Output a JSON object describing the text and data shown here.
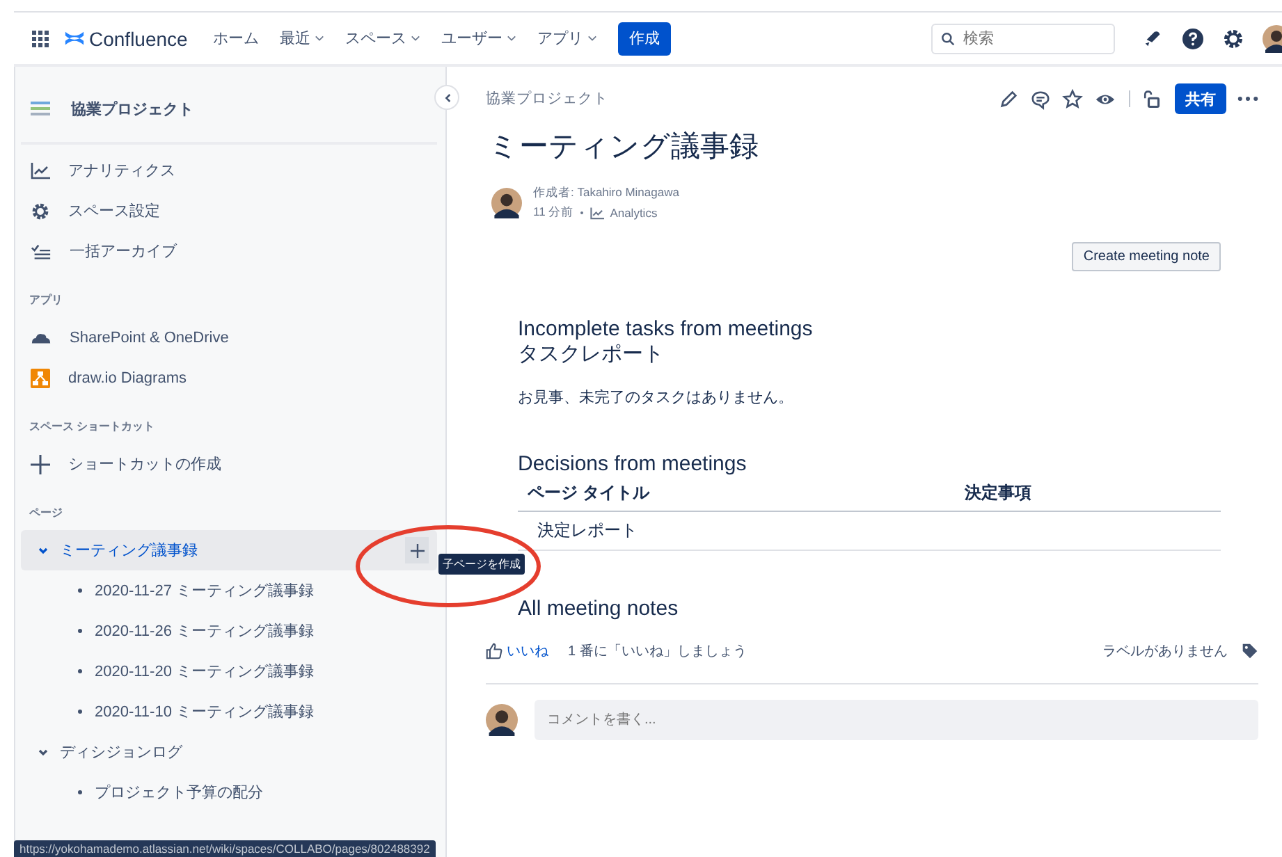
{
  "nav": {
    "brand": "Confluence",
    "menus": [
      {
        "label": "ホーム",
        "dropdown": false
      },
      {
        "label": "最近",
        "dropdown": true
      },
      {
        "label": "スペース",
        "dropdown": true
      },
      {
        "label": "ユーザー",
        "dropdown": true
      },
      {
        "label": "アプリ",
        "dropdown": true
      }
    ],
    "create_button": "作成",
    "search": {
      "placeholder": "検索"
    }
  },
  "sidebar": {
    "space_title": "協業プロジェクト",
    "items": [
      {
        "label": "アナリティクス"
      },
      {
        "label": "スペース設定"
      },
      {
        "label": "一括アーカイブ"
      }
    ],
    "apps_heading": "アプリ",
    "apps": [
      {
        "label": "SharePoint & OneDrive"
      },
      {
        "label": "draw.io Diagrams"
      }
    ],
    "shortcuts_heading": "スペース ショートカット",
    "shortcut_action": "ショートカットの作成",
    "pages_heading": "ページ",
    "pages": [
      {
        "label": "ミーティング議事録",
        "selected": true,
        "expanded": true,
        "children": [
          {
            "label": "2020-11-27 ミーティング議事録",
            "selected": false
          },
          {
            "label": "2020-11-26 ミーティング議事録",
            "selected": false
          },
          {
            "label": "2020-11-20 ミーティング議事録",
            "selected": false
          },
          {
            "label": "2020-11-10 ミーティング議事録",
            "selected": false
          }
        ]
      },
      {
        "label": "ディシジョンログ",
        "selected": false,
        "expanded": true,
        "children": [
          {
            "label": "プロジェクト予算の配分",
            "selected": false
          }
        ]
      }
    ],
    "tooltip": "子ページを作成"
  },
  "page": {
    "breadcrumb": "協業プロジェクト",
    "share_button": "共有",
    "title": "ミーティング議事録",
    "author": "作成者: Takahiro Minagawa",
    "time": "11 分前",
    "analytics": "Analytics",
    "create_meeting_note": "Create meeting note",
    "tasks_heading": [
      "Incomplete tasks from meetings",
      "タスクレポート"
    ],
    "tasks_text": "お見事、未完了のタスクはありません。",
    "decisions_heading": "Decisions from meetings",
    "table": {
      "columns": [
        "ページ タイトル",
        "決定事項"
      ],
      "rows": [
        [
          "決定レポート",
          ""
        ]
      ]
    },
    "all_notes_heading": "All meeting notes",
    "like": "いいね",
    "like_prompt": "1 番に「いいね」しましょう",
    "labels": "ラベルがありません",
    "comment": {
      "placeholder": "コメントを書く..."
    }
  },
  "status_bar": "https://yokohamademo.atlassian.net/wiki/spaces/COLLABO/pages/802488392"
}
